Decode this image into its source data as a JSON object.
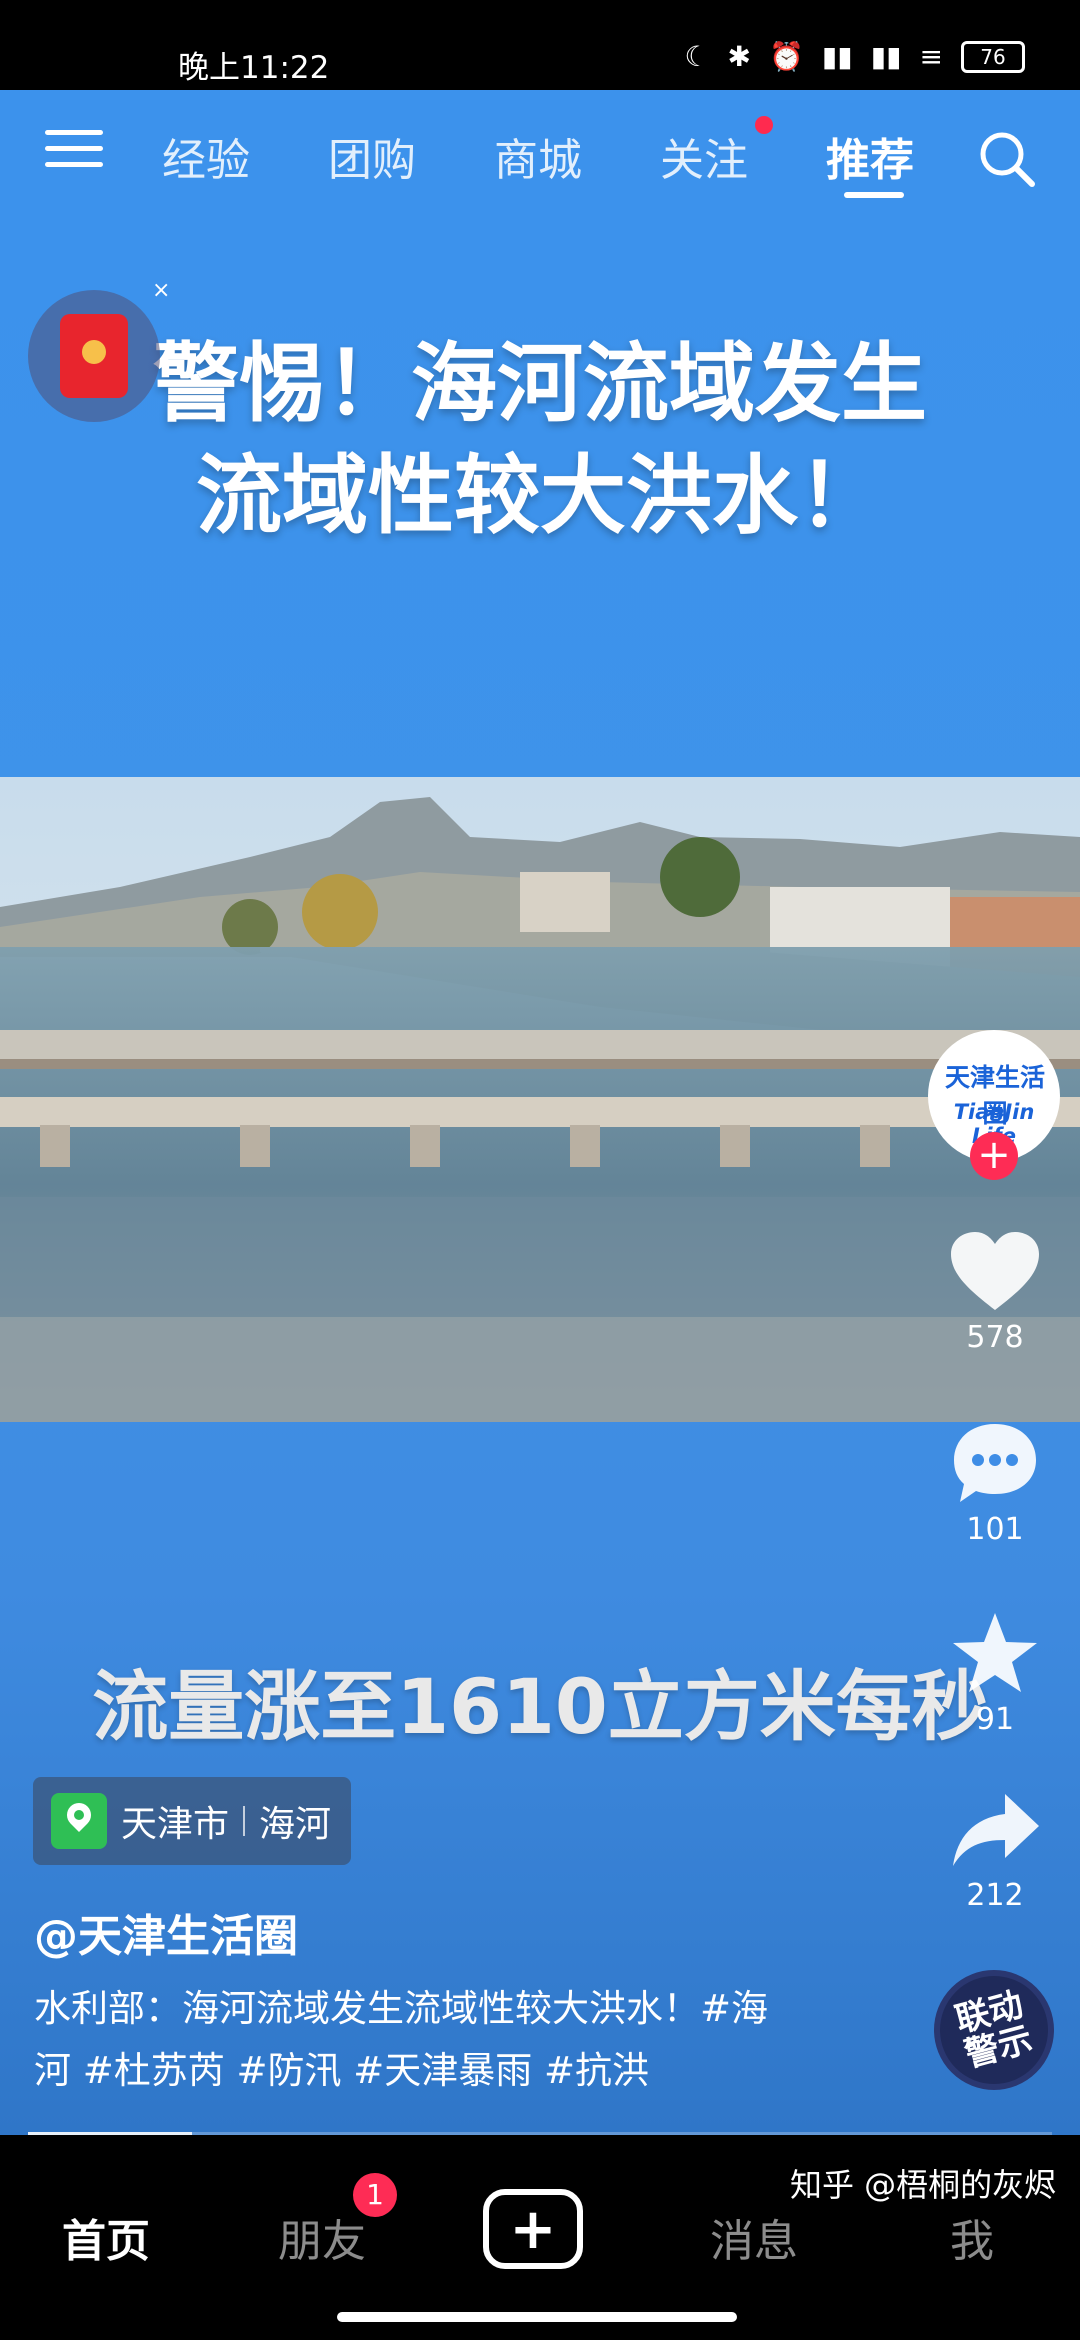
{
  "status_bar": {
    "time": "晚上11:22",
    "battery": "76"
  },
  "nav": {
    "tabs": [
      {
        "label": "经验"
      },
      {
        "label": "团购"
      },
      {
        "label": "商城"
      },
      {
        "label": "关注"
      },
      {
        "label": "推荐"
      }
    ],
    "active_tab": "推荐"
  },
  "redpacket": {
    "close": "×"
  },
  "video": {
    "headline_line1": "警惕！海河流域发生",
    "headline_line2": "流域性较大洪水！",
    "caption": "流量涨至1610立方米每秒",
    "location_city": "天津市",
    "location_place": "海河",
    "author": "@天津生活圈",
    "description_line1": "水利部：海河流域发生流域性较大洪水！#海",
    "description_line2": "河 #杜苏芮 #防汛 #天津暴雨 #抗洪",
    "progress": 0.16
  },
  "rail": {
    "avatar_line1": "天津生活圈",
    "avatar_line2": "TianJin Life",
    "follow": "+",
    "likes": "578",
    "comments": "101",
    "favorites": "91",
    "shares": "212",
    "music_text": "联动\n警示"
  },
  "bottom_nav": {
    "home": "首页",
    "friends": "朋友",
    "friends_badge": "1",
    "create": "+",
    "messages": "消息",
    "me": "我"
  },
  "watermark": "知乎 @梧桐的灰烬",
  "colors": {
    "accent_red": "#fe2c55",
    "video_bg": "#3c92ec"
  }
}
